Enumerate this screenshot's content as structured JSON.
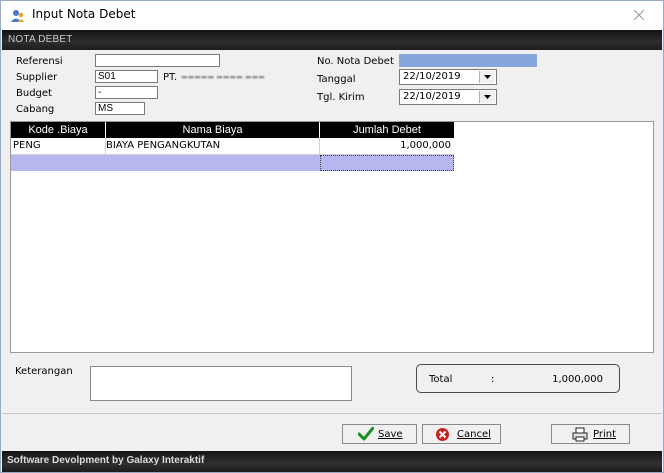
{
  "window": {
    "title": "Input  Nota Debet",
    "section_title": "NOTA DEBET"
  },
  "form": {
    "referensi_label": "Referensi",
    "referensi_value": "",
    "supplier_label": "Supplier",
    "supplier_code": "S01",
    "supplier_name": "PT.",
    "budget_label": "Budget",
    "budget_value": "-",
    "cabang_label": "Cabang",
    "cabang_value": "MS",
    "no_nota_label": "No. Nota Debet",
    "no_nota_value": "",
    "tanggal_label": "Tanggal",
    "tanggal_value": "22/10/2019",
    "tgl_kirim_label": "Tgl. Kirim",
    "tgl_kirim_value": "22/10/2019"
  },
  "grid": {
    "headers": [
      "Kode .Biaya",
      "Nama Biaya",
      "Jumlah  Debet"
    ],
    "rows": [
      {
        "kode": "PENG",
        "nama": "BIAYA PENGANGKUTAN",
        "jumlah": "1,000,000"
      }
    ]
  },
  "summary": {
    "keterangan_label": "Keterangan",
    "keterangan_value": "",
    "total_label": "Total",
    "total_sep": ":",
    "total_value": "1,000,000"
  },
  "buttons": {
    "save": "Save",
    "cancel": "Cancel",
    "print": "Print"
  },
  "footer": "Software Devolpment by Galaxy Interaktif",
  "colors": {
    "selection": "#b7b6ee",
    "no_nota_fill": "#87a7dc",
    "header_bg": "#000000",
    "save_check": "#1e8f1e",
    "cancel_red": "#c81e1e"
  },
  "icons": {
    "app": "user-icon",
    "close": "close-icon",
    "save": "checkmark-icon",
    "cancel": "cancel-icon",
    "print": "printer-icon",
    "dropdown": "chevron-down-icon"
  }
}
